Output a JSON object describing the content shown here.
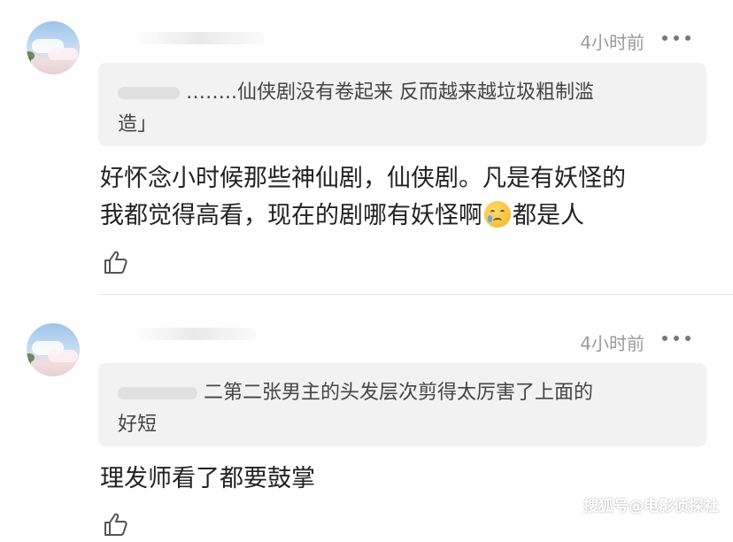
{
  "comments": [
    {
      "time": "4小时前",
      "quote_line1": "……..仙侠剧没有卷起来 反而越来越垃圾粗制滥",
      "quote_line2": "造」",
      "body_line1": "好怀念小时候那些神仙剧，仙侠剧。凡是有妖怪的",
      "body_line2a": "我都觉得高看，现在的剧哪有妖怪啊",
      "emoji": "crying-face",
      "body_line2b": "都是人"
    },
    {
      "time": "4小时前",
      "quote_line1": "二第二张男主的头发层次剪得太厉害了上面的",
      "quote_line2": "好短",
      "body_line1": "理发师看了都要鼓掌"
    }
  ],
  "icons": {
    "more": "more-dots-icon",
    "like": "thumbs-up-icon"
  },
  "colors": {
    "quote_bg": "#f2f2f2",
    "time_text": "#9a9a9a"
  },
  "watermark": "搜狐号@电影侦探社"
}
